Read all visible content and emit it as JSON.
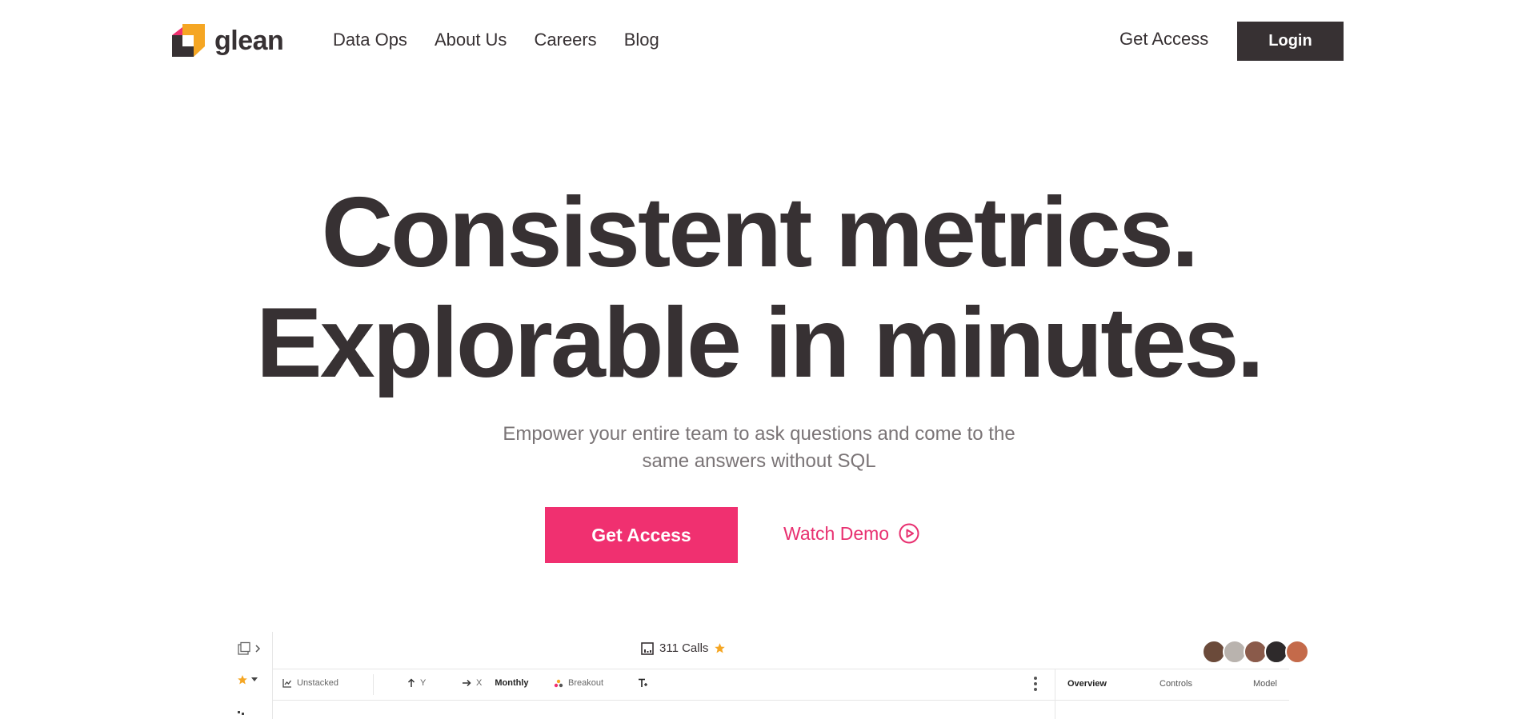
{
  "brand": {
    "name": "glean",
    "colors": {
      "orange": "#f5a623",
      "pink": "#f03070",
      "dark": "#373133"
    }
  },
  "nav": {
    "items": [
      "Data Ops",
      "About Us",
      "Careers",
      "Blog"
    ]
  },
  "header": {
    "get_access": "Get Access",
    "login": "Login"
  },
  "hero": {
    "line1": "Consistent metrics.",
    "line2": "Explorable in minutes.",
    "subtitle_line1": "Empower your entire team to ask questions and come to the",
    "subtitle_line2": "same answers without SQL",
    "cta_primary": "Get Access",
    "cta_secondary": "Watch Demo"
  },
  "preview": {
    "title": "311 Calls",
    "toolbar": {
      "stack": "Unstacked",
      "y": "Y",
      "x": "X",
      "interval": "Monthly",
      "breakout": "Breakout"
    },
    "panel_tabs": [
      "Overview",
      "Controls",
      "Model"
    ],
    "avatars": [
      "#6b4a3a",
      "#b9b3ae",
      "#8a5a4a",
      "#2e2a2b",
      "#c46a4a"
    ],
    "icons": [
      "sidebar-toggle-icon",
      "star-icon",
      "chart-icon",
      "arrow-up-icon",
      "arrow-right-icon",
      "breakout-icon",
      "filter-icon",
      "more-icon"
    ]
  }
}
